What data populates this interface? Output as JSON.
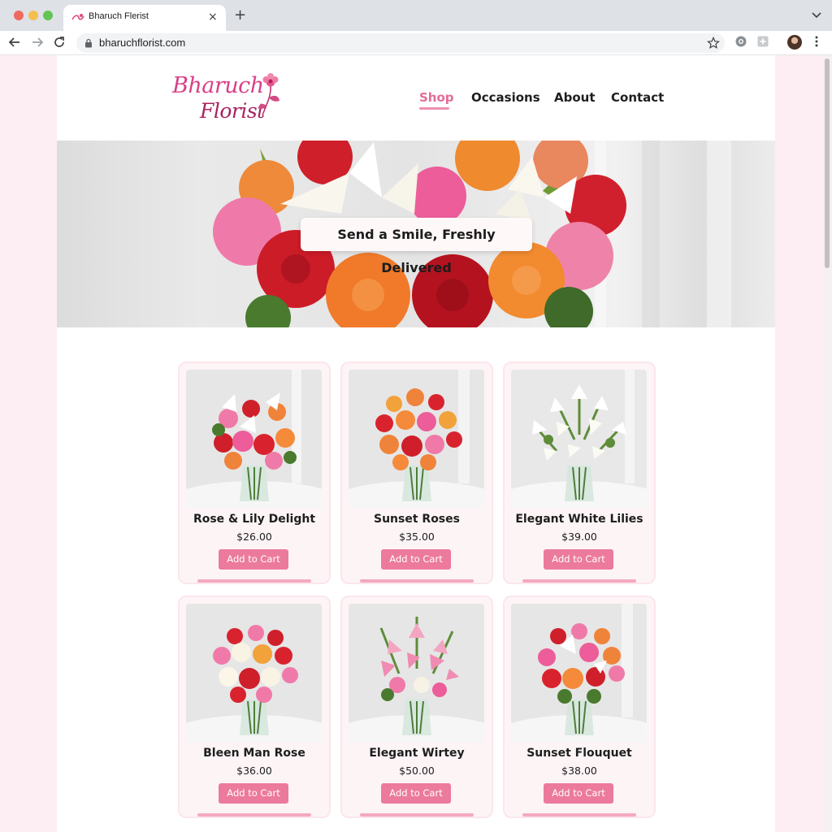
{
  "browser": {
    "tab_title": "Bharuch Flerist",
    "new_tab": "+",
    "tab_close": "×",
    "url": "bharuchflorist.com"
  },
  "site": {
    "logo_line1": "Bharuch",
    "logo_line2": "Florist",
    "nav": {
      "shop": "Shop",
      "occasions": "Occasions",
      "about": "About",
      "contact": "Contact"
    },
    "hero_caption": "Send a Smile, Freshly Delivered"
  },
  "products": [
    {
      "name": "Rose & Lily Delight",
      "price": "$26.00",
      "button": "Add to Cart"
    },
    {
      "name": "Sunset Roses",
      "price": "$35.00",
      "button": "Add to Cart"
    },
    {
      "name": "Elegant White Lilies",
      "price": "$39.00",
      "button": "Add to Cart"
    },
    {
      "name": "Bleen Man Rose",
      "price": "$36.00",
      "button": "Add to Cart"
    },
    {
      "name": "Elegant Wirtey",
      "price": "$50.00",
      "button": "Add to Cart"
    },
    {
      "name": "Sunset Flouquet",
      "price": "$38.00",
      "button": "Add to Cart"
    }
  ],
  "colors": {
    "brand_pink": "#e46c98",
    "button_pink": "#ec7a9c",
    "page_background": "#fdeef3"
  },
  "icons": [
    "back-arrow-icon",
    "forward-arrow-icon",
    "reload-icon",
    "lock-icon",
    "bookmark-star-icon",
    "extension-icon",
    "profile-avatar",
    "menu-icon",
    "tab-list-chevron-icon"
  ]
}
